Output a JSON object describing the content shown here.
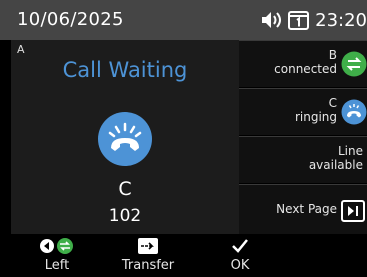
{
  "status_bar": {
    "date": "10/06/2025",
    "time": "23:20",
    "icons": [
      "speaker-icon",
      "line-key-1-icon"
    ]
  },
  "main_call": {
    "line_tag": "A",
    "state": "Call Waiting",
    "caller_name": "C",
    "caller_number": "102",
    "icon": "ringing-handset-icon",
    "accent_color": "#4d93d6"
  },
  "side_items": [
    {
      "line1": "B",
      "line2": "connected",
      "icon": "connected-transfer-icon",
      "icon_color": "#3fae49"
    },
    {
      "line1": "C",
      "line2": "ringing",
      "icon": "ringing-handset-icon",
      "icon_color": "#4d93d6"
    },
    {
      "line1": "Line",
      "line2": "available",
      "icon": ""
    },
    {
      "line1": "Next Page",
      "line2": "",
      "icon": "next-page-icon"
    }
  ],
  "softkeys": [
    {
      "label": "Left",
      "icon": "left-connected-icon"
    },
    {
      "label": "Transfer",
      "icon": "transfer-icon"
    },
    {
      "label": "OK",
      "icon": "checkmark-icon"
    }
  ]
}
